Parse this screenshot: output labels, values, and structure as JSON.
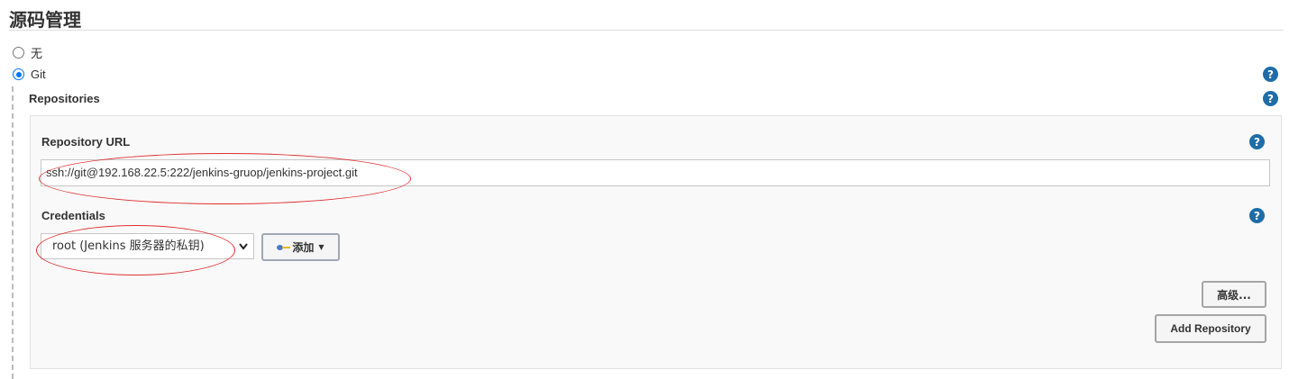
{
  "section": {
    "title": "源码管理"
  },
  "scm": {
    "none_label": "无",
    "git_label": "Git",
    "selected": "Git"
  },
  "repositories": {
    "label": "Repositories",
    "repository_url_label": "Repository URL",
    "repository_url_value": "ssh://git@192.168.22.5:222/jenkins-gruop/jenkins-project.git",
    "credentials_label": "Credentials",
    "credentials_selected": "root (Jenkins 服务器的私钥)",
    "add_button_label": "添加",
    "advanced_button_label": "高级...",
    "add_repository_label": "Add Repository"
  },
  "help_icon_glyph": "?",
  "colors": {
    "help_icon": "#1e6da8",
    "annotation_ellipse": "#e03030",
    "radio_checked": "#0075ff"
  }
}
